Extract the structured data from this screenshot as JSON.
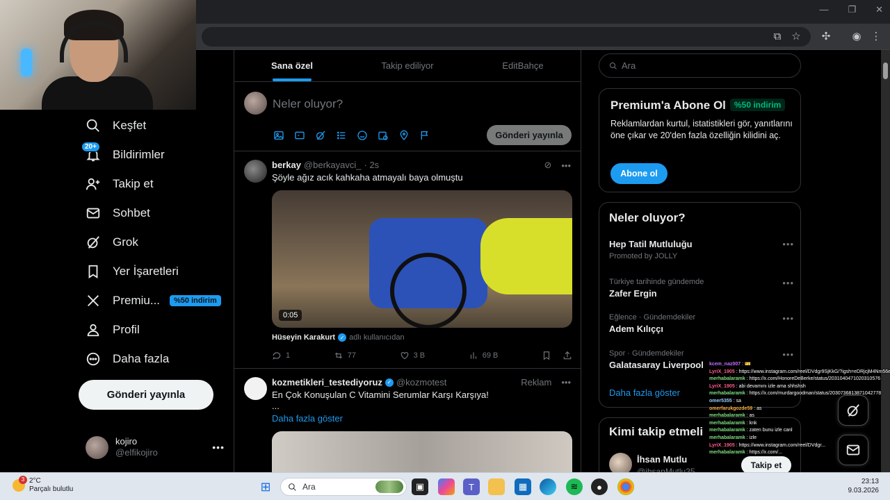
{
  "tabs": [
    "Sana özel",
    "Takip ediliyor",
    "EditBahçe"
  ],
  "nav": {
    "items": [
      {
        "label": "Keşfet",
        "icon": "search-icon"
      },
      {
        "label": "Bildirimler",
        "icon": "bell-icon",
        "badge": "20+"
      },
      {
        "label": "Takip et",
        "icon": "add-user-icon"
      },
      {
        "label": "Sohbet",
        "icon": "mail-icon"
      },
      {
        "label": "Grok",
        "icon": "grok-icon"
      },
      {
        "label": "Yer İşaretleri",
        "icon": "bookmark-icon"
      },
      {
        "label": "Premiu...",
        "icon": "x-logo-icon",
        "badge": "%50 indirim"
      },
      {
        "label": "Profil",
        "icon": "person-icon"
      },
      {
        "label": "Daha fazla",
        "icon": "more-circle-icon"
      }
    ],
    "post_button": "Gönderi yayınla",
    "profile": {
      "name": "kojiro",
      "handle": "@elfikojiro"
    }
  },
  "composer": {
    "placeholder": "Neler oluyor?",
    "post_button": "Gönderi yayınla"
  },
  "tweets": [
    {
      "name": "berkay",
      "handle": "@berkayavci_",
      "time": "· 2s",
      "text": "Şöyle ağız acık kahkaha atmayalı baya olmuştu",
      "video_duration": "0:05",
      "credit_name": "Hüseyin Karakurt",
      "credit_sub": "adlı kullanıcıdan",
      "replies": "1",
      "reposts": "77",
      "likes": "3 B",
      "views": "69 B"
    },
    {
      "name": "kozmetikleri_testediyoruz",
      "handle": "@kozmotest",
      "tag": "Reklam",
      "text": "En Çok Konuşulan C Vitamini Serumlar Karşı Karşıya!",
      "ellipsis": "...",
      "show_more": "Daha fazla göster"
    }
  ],
  "search": {
    "placeholder": "Ara"
  },
  "premium": {
    "title": "Premium'a Abone Ol",
    "pill": "%50 indirim",
    "body": "Reklamlardan kurtul, istatistikleri gör, yanıtlarını öne çıkar ve 20'den fazla özelliğin kilidini aç.",
    "button": "Abone ol"
  },
  "trends": {
    "title": "Neler oluyor?",
    "items": [
      {
        "context": "",
        "title": "Hep Tatil Mutluluğu",
        "promoted": "Promoted by JOLLY"
      },
      {
        "context": "Türkiye tarihinde gündemde",
        "title": "Zafer Ergin"
      },
      {
        "context": "Eğlence · Gündemdekiler",
        "title": "Adem Kılıççı"
      },
      {
        "context": "Spor · Gündemdekiler",
        "title": "Galatasaray Liverpool"
      }
    ],
    "show_more": "Daha fazla göster"
  },
  "who_to_follow": {
    "title": "Kimi takip etmeli",
    "name": "İhsan Mutlu",
    "handle": "@ihsanMutlu35",
    "follow_button": "Takip et"
  },
  "chat": [
    {
      "user": "kcem_naz007",
      "msg": ": 🎫",
      "color": "#c070ff"
    },
    {
      "user": "LyriX_1905",
      "msg": ": https://www.instagram.com/reel/DVdgr9SjKkG/?igsh=eDRjcjM4Nm56ejdw",
      "color": "#ff5c8a"
    },
    {
      "user": "merhabalaramk",
      "msg": ": https://x.com/HonoreDeBerke/status/2031040471020310576",
      "color": "#7fe07f"
    },
    {
      "user": "LyriX_1905",
      "msg": ": abi devamını izle ama shhshsh",
      "color": "#ff5c8a"
    },
    {
      "user": "merhabalaramk",
      "msg": ": https://x.com/murdargoodman/status/2030736813871042778",
      "color": "#7fe07f"
    },
    {
      "user": "omer5355",
      "msg": ": sa",
      "color": "#9ad1ff"
    },
    {
      "user": "omerfarukgozde59",
      "msg": ": as",
      "color": "#ffb347"
    },
    {
      "user": "merhabalaramk",
      "msg": ": as",
      "color": "#7fe07f"
    },
    {
      "user": "merhabalaramk",
      "msg": ": knk",
      "color": "#7fe07f"
    },
    {
      "user": "merhabalaramk",
      "msg": ": zaten bunu izle canl",
      "color": "#7fe07f"
    },
    {
      "user": "merhabalaramk",
      "msg": ": izle",
      "color": "#7fe07f"
    },
    {
      "user": "LyriX_1905",
      "msg": ": https://www.instagram.com/reel/DVdgr...",
      "color": "#ff5c8a"
    },
    {
      "user": "merhabalaramk",
      "msg": ": https://x.com/...",
      "color": "#7fe07f"
    }
  ],
  "taskbar": {
    "weather_temp": "2°C",
    "weather_desc": "Parçalı bulutlu",
    "weather_badge": "3",
    "search_placeholder": "Ara",
    "time": "23:13",
    "date": "9.03.2026"
  },
  "colors": {
    "accent": "#1d9bf0",
    "background": "#000000",
    "border": "#2f3336",
    "muted": "#71767b"
  }
}
